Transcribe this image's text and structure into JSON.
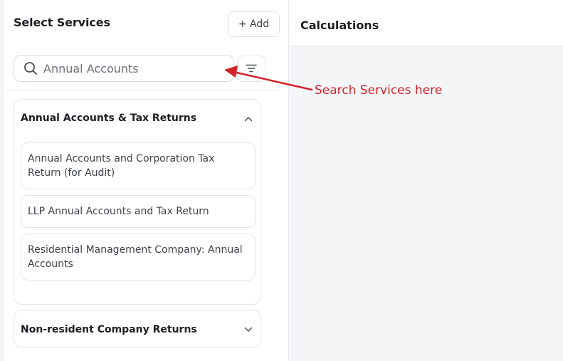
{
  "left_panel": {
    "title": "Select Services",
    "add_button": "+ Add",
    "search": {
      "value": "Annual Accounts",
      "icon": "search-icon"
    },
    "filter_icon": "filter-icon",
    "groups": [
      {
        "title": "Annual Accounts & Tax Returns",
        "expanded": true,
        "chevron": "chevron-up-icon",
        "items": [
          {
            "label": "Annual Accounts and Corporation Tax Return (for Audit)"
          },
          {
            "label": "LLP Annual Accounts and Tax Return"
          },
          {
            "label": "Residential Management Company: Annual Accounts"
          }
        ]
      },
      {
        "title": "Non-resident Company Returns",
        "expanded": false,
        "chevron": "chevron-down-icon",
        "items": []
      }
    ]
  },
  "right_panel": {
    "title": "Calculations"
  },
  "annotation": {
    "text": "Search Services here",
    "color": "#d2232a"
  },
  "colors": {
    "border": "#e2e5e9",
    "panel_bg": "#f4f5f7",
    "annotation": "#d2232a"
  }
}
